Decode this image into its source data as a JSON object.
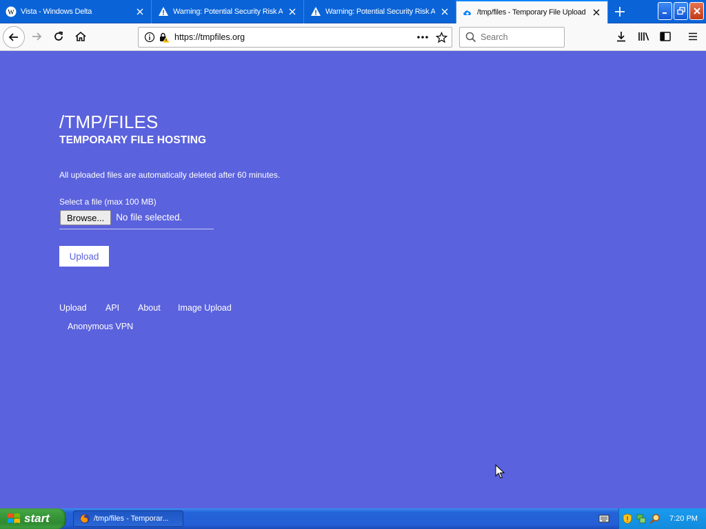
{
  "browser": {
    "tabs": [
      {
        "title": "Vista - Windows Delta",
        "icon": "wikipedia-w-icon",
        "active": false
      },
      {
        "title": "Warning: Potential Security Risk Ah",
        "icon": "warning-icon",
        "active": false
      },
      {
        "title": "Warning: Potential Security Risk Ah",
        "icon": "warning-icon",
        "active": false
      },
      {
        "title": "/tmp/files - Temporary File Upload",
        "icon": "cloud-upload-icon",
        "active": true
      }
    ],
    "url": "https://tmpfiles.org",
    "search_placeholder": "Search"
  },
  "page": {
    "title": "/TMP/FILES",
    "subtitle": "TEMPORARY FILE HOSTING",
    "notice": "All uploaded files are automatically deleted after 60 minutes.",
    "file_label": "Select a file (max 100 MB)",
    "browse_label": "Browse...",
    "no_file_text": "No file selected.",
    "upload_label": "Upload",
    "footer_links": [
      "Upload",
      "API",
      "About",
      "Image Upload",
      "Anonymous VPN"
    ]
  },
  "taskbar": {
    "start_label": "start",
    "task_label": "/tmp/files - Temporar...",
    "clock": "7:20 PM"
  },
  "colors": {
    "page_background": "#5b62dd",
    "taskbar_blue": "#245ed6",
    "start_green": "#3a9a3c"
  }
}
